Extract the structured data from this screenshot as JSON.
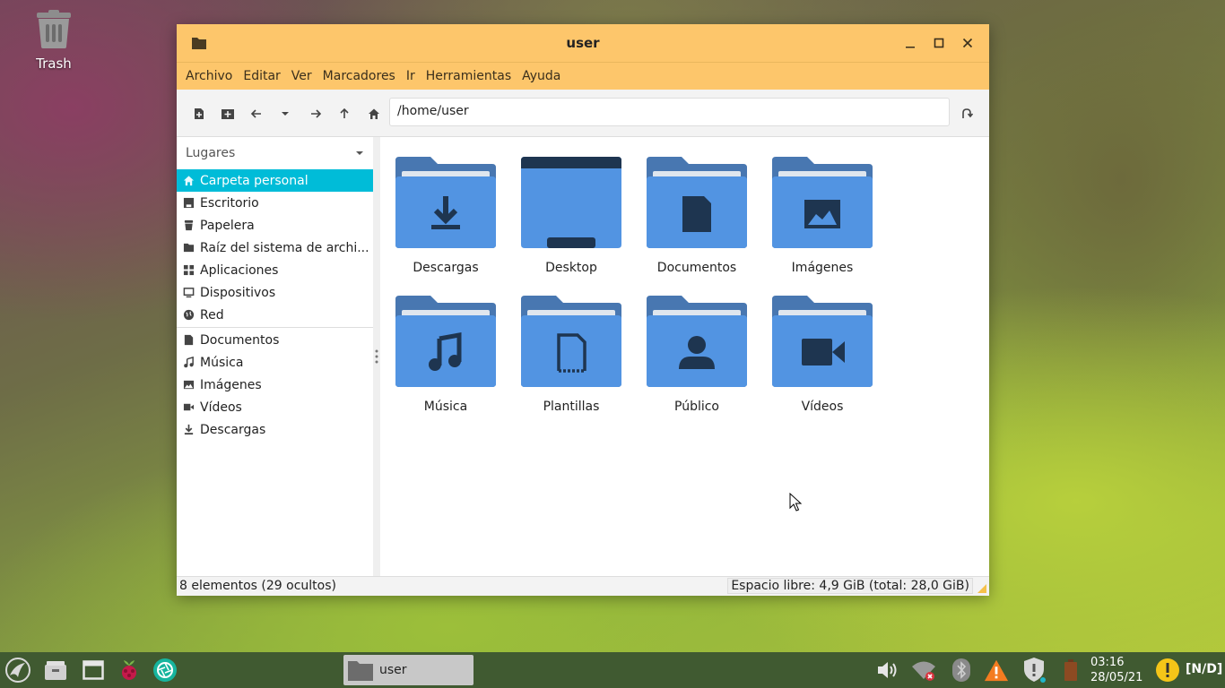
{
  "desktop": {
    "trash_label": "Trash"
  },
  "window": {
    "title": "user",
    "menu": [
      "Archivo",
      "Editar",
      "Ver",
      "Marcadores",
      "Ir",
      "Herramientas",
      "Ayuda"
    ],
    "path": "/home/user",
    "sidebar": {
      "header": "Lugares",
      "places": [
        {
          "label": "Carpeta personal",
          "icon": "home-icon"
        },
        {
          "label": "Escritorio",
          "icon": "desktop-icon"
        },
        {
          "label": "Papelera",
          "icon": "trash-icon"
        },
        {
          "label": "Raíz del sistema de archi...",
          "icon": "folder-icon"
        },
        {
          "label": "Aplicaciones",
          "icon": "apps-icon"
        },
        {
          "label": "Dispositivos",
          "icon": "monitor-icon"
        },
        {
          "label": "Red",
          "icon": "globe-icon"
        }
      ],
      "bookmarks": [
        {
          "label": "Documentos",
          "icon": "document-icon"
        },
        {
          "label": "Música",
          "icon": "music-icon"
        },
        {
          "label": "Imágenes",
          "icon": "image-icon"
        },
        {
          "label": "Vídeos",
          "icon": "video-icon"
        },
        {
          "label": "Descargas",
          "icon": "download-icon"
        }
      ]
    },
    "folders": [
      {
        "label": "Descargas",
        "icon": "download-icon"
      },
      {
        "label": "Desktop",
        "icon": "desktop-folder-icon"
      },
      {
        "label": "Documentos",
        "icon": "document-icon"
      },
      {
        "label": "Imágenes",
        "icon": "image-icon"
      },
      {
        "label": "Música",
        "icon": "music-icon"
      },
      {
        "label": "Plantillas",
        "icon": "template-icon"
      },
      {
        "label": "Público",
        "icon": "person-icon"
      },
      {
        "label": "Vídeos",
        "icon": "video-icon"
      }
    ],
    "status_left": "8 elementos (29 ocultos)",
    "status_right": "Espacio libre: 4,9 GiB (total: 28,0 GiB)"
  },
  "taskbar": {
    "task_label": "user",
    "time": "03:16",
    "date": "28/05/21",
    "indicator": "[N/D]"
  },
  "colors": {
    "titlebar": "#fdc66b",
    "selection": "#00bcd8",
    "folder": "#5294e2",
    "folder_dark": "#4877b1",
    "glyph": "#1e3550",
    "taskbar": "#405a31"
  }
}
